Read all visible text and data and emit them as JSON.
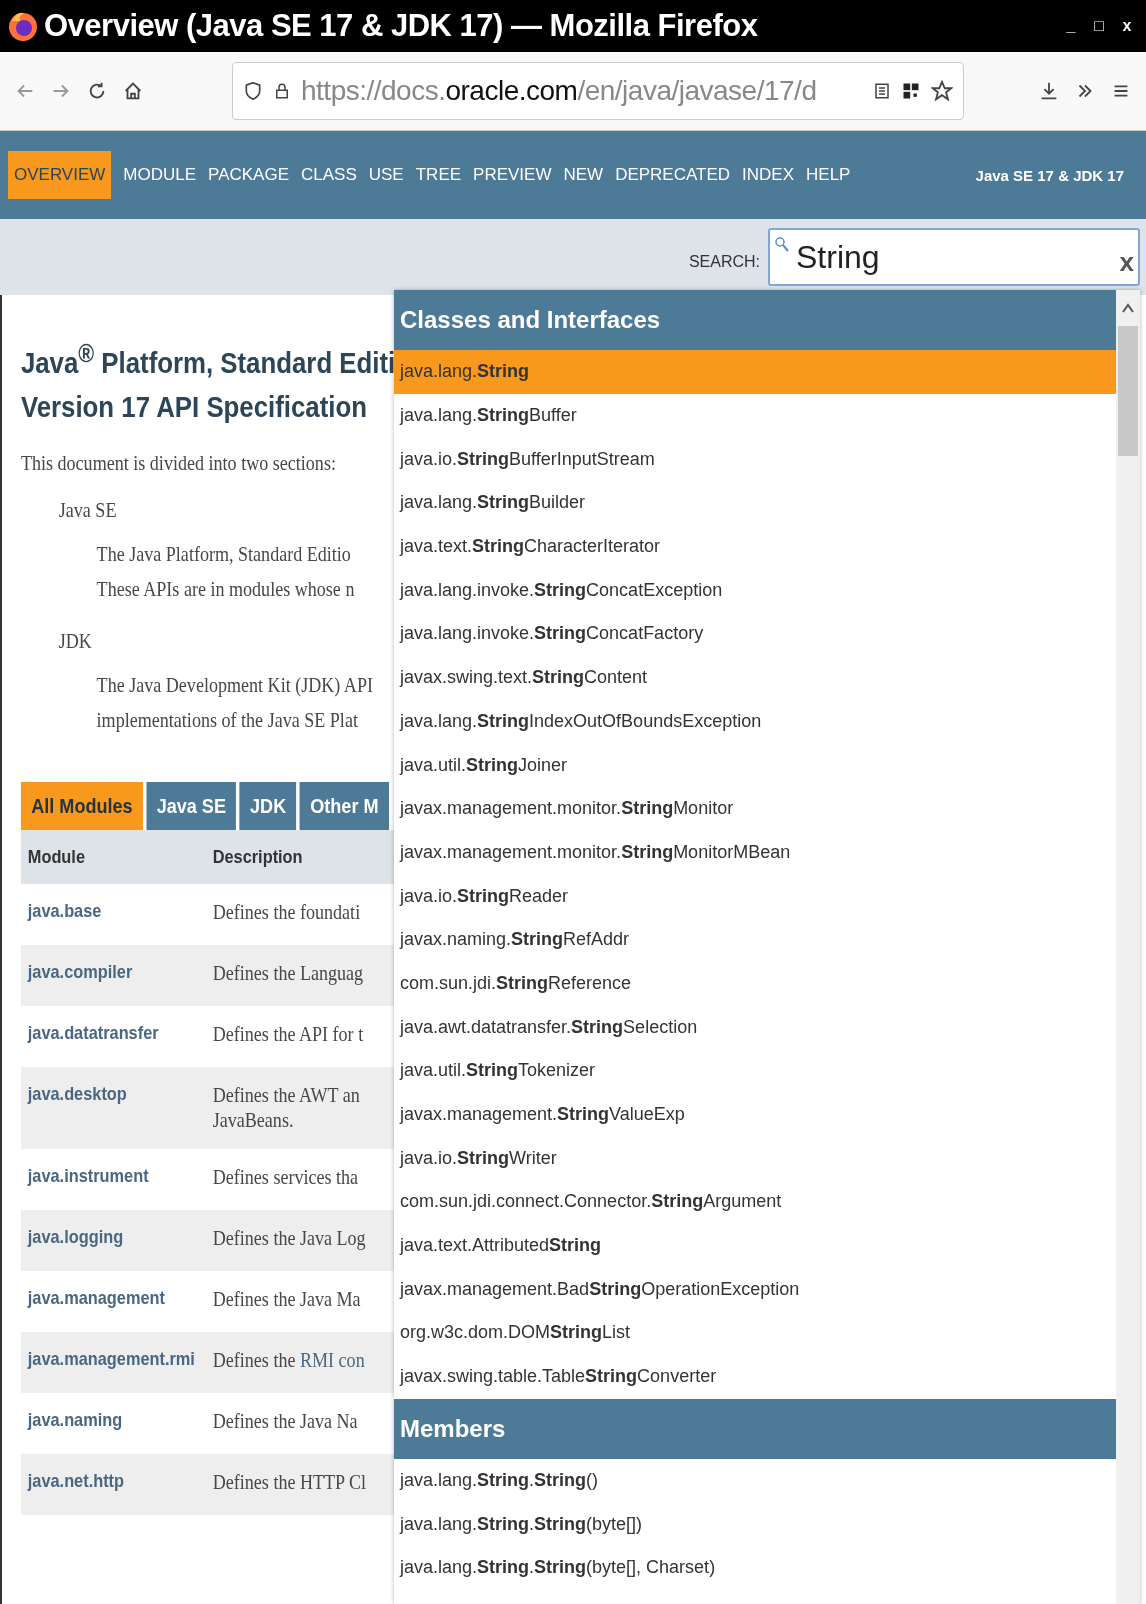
{
  "window": {
    "title": "Overview (Java SE 17 & JDK 17) — Mozilla Firefox",
    "controls": [
      "_",
      "□",
      "x"
    ]
  },
  "toolbar": {
    "url_prefix": "https://docs.",
    "url_domain": "oracle.com",
    "url_rest": "/en/java/javase/17/d"
  },
  "nav": {
    "items": [
      {
        "label": "OVERVIEW",
        "selected": true
      },
      {
        "label": "MODULE",
        "selected": false
      },
      {
        "label": "PACKAGE",
        "selected": false
      },
      {
        "label": "CLASS",
        "selected": false
      },
      {
        "label": "USE",
        "selected": false
      },
      {
        "label": "TREE",
        "selected": false
      },
      {
        "label": "PREVIEW",
        "selected": false
      },
      {
        "label": "NEW",
        "selected": false
      },
      {
        "label": "DEPRECATED",
        "selected": false
      },
      {
        "label": "INDEX",
        "selected": false
      },
      {
        "label": "HELP",
        "selected": false
      }
    ],
    "version": "Java SE 17 & JDK 17"
  },
  "search": {
    "label": "SEARCH:",
    "value": "String",
    "clear": "x"
  },
  "page": {
    "heading_line1": "Java$^{®}$ Platform, Standard Editi",
    "heading_line2": "Version 17 API Specification",
    "intro": "This document is divided into two sections:",
    "sections": [
      {
        "term": "Java SE",
        "lines": [
          "The Java Platform, Standard Editio",
          "These APIs are in modules whose n"
        ]
      },
      {
        "term": "JDK",
        "lines": [
          "The Java Development Kit (JDK) API",
          "implementations of the Java SE Plat"
        ]
      }
    ]
  },
  "module_tabs": [
    {
      "label": "All Modules",
      "selected": true
    },
    {
      "label": "Java SE",
      "selected": false
    },
    {
      "label": "JDK",
      "selected": false
    },
    {
      "label": "Other M",
      "selected": false
    }
  ],
  "table": {
    "columns": [
      "Module",
      "Description"
    ],
    "rows": [
      {
        "module": "java.base",
        "description": [
          "Defines the foundati"
        ]
      },
      {
        "module": "java.compiler",
        "description": [
          "Defines the Languag"
        ]
      },
      {
        "module": "java.datatransfer",
        "description": [
          "Defines the API for t"
        ]
      },
      {
        "module": "java.desktop",
        "description": [
          "Defines the AWT an",
          "JavaBeans."
        ]
      },
      {
        "module": "java.instrument",
        "description": [
          "Defines services tha"
        ]
      },
      {
        "module": "java.logging",
        "description": [
          "Defines the Java Log"
        ]
      },
      {
        "module": "java.management",
        "description": [
          "Defines the Java Ma"
        ]
      },
      {
        "module": "java.management.rmi",
        "description": [
          "Defines the ",
          "RMI con"
        ]
      },
      {
        "module": "java.naming",
        "description": [
          "Defines the Java Na"
        ]
      },
      {
        "module": "java.net.http",
        "description": [
          "Defines the HTTP Cl"
        ]
      }
    ]
  },
  "results": {
    "groups": [
      {
        "title": "Classes and Interfaces",
        "items": [
          {
            "text": "java.lang.**String**",
            "selected": true
          },
          {
            "text": "java.lang.**String**Buffer",
            "selected": false
          },
          {
            "text": "java.io.**String**BufferInputStream",
            "selected": false
          },
          {
            "text": "java.lang.**String**Builder",
            "selected": false
          },
          {
            "text": "java.text.**String**CharacterIterator",
            "selected": false
          },
          {
            "text": "java.lang.invoke.**String**ConcatException",
            "selected": false
          },
          {
            "text": "java.lang.invoke.**String**ConcatFactory",
            "selected": false
          },
          {
            "text": "javax.swing.text.**String**Content",
            "selected": false
          },
          {
            "text": "java.lang.**String**IndexOutOfBoundsException",
            "selected": false
          },
          {
            "text": "java.util.**String**Joiner",
            "selected": false
          },
          {
            "text": "javax.management.monitor.**String**Monitor",
            "selected": false
          },
          {
            "text": "javax.management.monitor.**String**MonitorMBean",
            "selected": false
          },
          {
            "text": "java.io.**String**Reader",
            "selected": false
          },
          {
            "text": "javax.naming.**String**RefAddr",
            "selected": false
          },
          {
            "text": "com.sun.jdi.**String**Reference",
            "selected": false
          },
          {
            "text": "java.awt.datatransfer.**String**Selection",
            "selected": false
          },
          {
            "text": "java.util.**String**Tokenizer",
            "selected": false
          },
          {
            "text": "javax.management.**String**ValueExp",
            "selected": false
          },
          {
            "text": "java.io.**String**Writer",
            "selected": false
          },
          {
            "text": "com.sun.jdi.connect.Connector.**String**Argument",
            "selected": false
          },
          {
            "text": "java.text.Attributed**String**",
            "selected": false
          },
          {
            "text": "javax.management.Bad**String**OperationException",
            "selected": false
          },
          {
            "text": "org.w3c.dom.DOM**String**List",
            "selected": false
          },
          {
            "text": "javax.swing.table.Table**String**Converter",
            "selected": false
          }
        ]
      },
      {
        "title": "Members",
        "items": [
          {
            "text": "java.lang.**String**.**String**()",
            "selected": false
          },
          {
            "text": "java.lang.**String**.**String**(byte[])",
            "selected": false
          },
          {
            "text": "java.lang.**String**.**String**(byte[], Charset)",
            "selected": false
          }
        ]
      }
    ]
  }
}
